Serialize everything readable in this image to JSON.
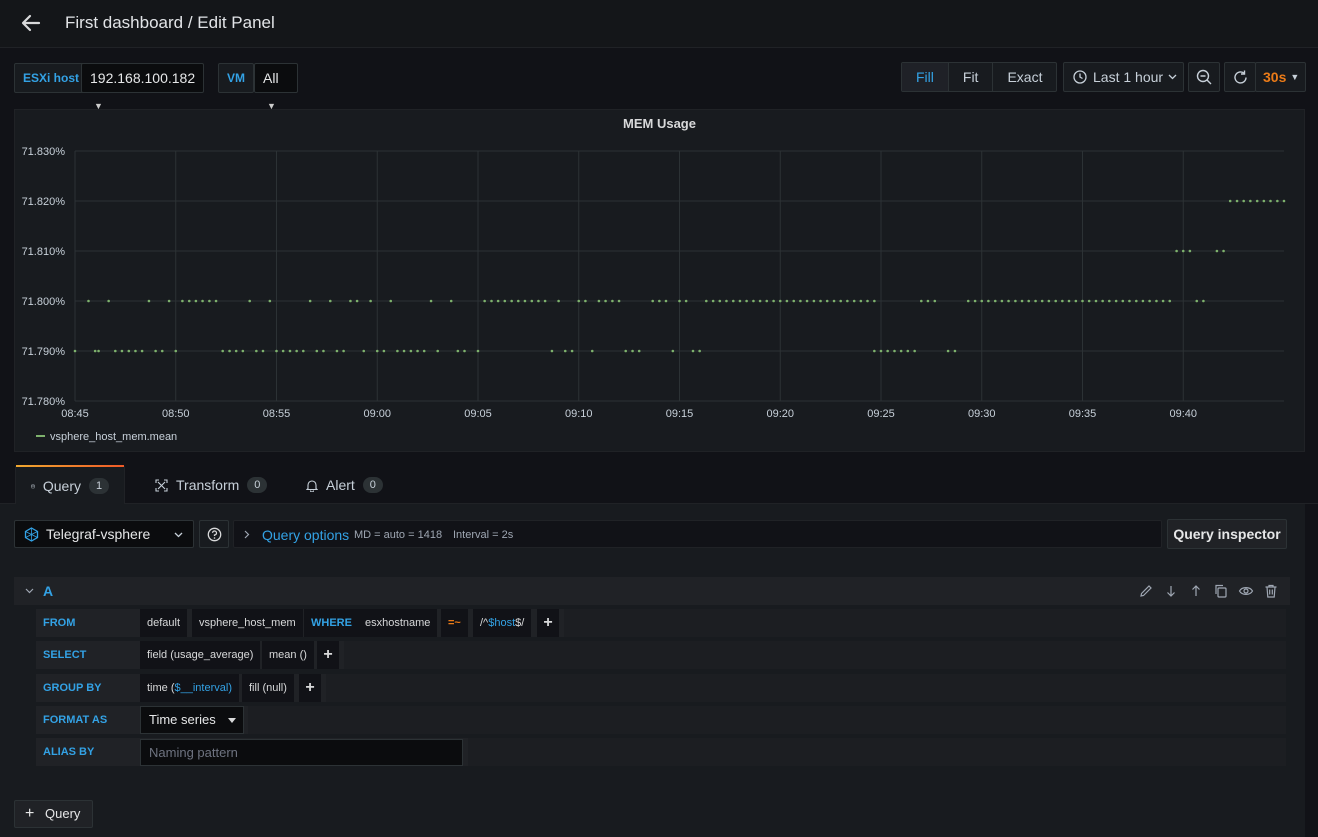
{
  "header": {
    "title": "First dashboard / Edit Panel",
    "back_icon": "arrow-left-icon"
  },
  "variables": {
    "esxi_label": "ESXi host",
    "esxi_value": "192.168.100.182",
    "vm_label": "VM",
    "vm_value": "All"
  },
  "view_modes": {
    "fill": "Fill",
    "fit": "Fit",
    "exact": "Exact",
    "active": "Fill"
  },
  "time_picker": {
    "range": "Last 1 hour",
    "refresh": "30s"
  },
  "panel": {
    "title": "MEM Usage"
  },
  "chart_data": {
    "type": "scatter",
    "title": "MEM Usage",
    "xlabel": "",
    "ylabel": "",
    "x_ticks": [
      "08:45",
      "08:50",
      "08:55",
      "09:00",
      "09:05",
      "09:10",
      "09:15",
      "09:20",
      "09:25",
      "09:30",
      "09:35",
      "09:40"
    ],
    "y_ticks": [
      "71.830%",
      "71.820%",
      "71.810%",
      "71.800%",
      "71.790%",
      "71.780%"
    ],
    "ylim": [
      71.78,
      71.83
    ],
    "xlim_minutes": [
      0,
      60
    ],
    "grid": true,
    "legend_position": "bottom-left",
    "series_color": "#7eb26d",
    "series": [
      {
        "name": "vsphere_host_mem.mean",
        "points": [
          [
            0.0,
            71.79
          ],
          [
            0.67,
            71.8
          ],
          [
            1.0,
            71.79
          ],
          [
            1.17,
            71.79
          ],
          [
            1.67,
            71.8
          ],
          [
            2.0,
            71.79
          ],
          [
            2.33,
            71.79
          ],
          [
            2.67,
            71.79
          ],
          [
            3.0,
            71.79
          ],
          [
            3.33,
            71.79
          ],
          [
            3.67,
            71.8
          ],
          [
            4.0,
            71.79
          ],
          [
            4.33,
            71.79
          ],
          [
            4.67,
            71.8
          ],
          [
            5.0,
            71.79
          ],
          [
            5.33,
            71.8
          ],
          [
            5.67,
            71.8
          ],
          [
            6.0,
            71.8
          ],
          [
            6.33,
            71.8
          ],
          [
            6.67,
            71.8
          ],
          [
            7.0,
            71.8
          ],
          [
            7.33,
            71.79
          ],
          [
            7.67,
            71.79
          ],
          [
            8.0,
            71.79
          ],
          [
            8.33,
            71.79
          ],
          [
            8.67,
            71.8
          ],
          [
            9.0,
            71.79
          ],
          [
            9.33,
            71.79
          ],
          [
            9.67,
            71.8
          ],
          [
            10.0,
            71.79
          ],
          [
            10.33,
            71.79
          ],
          [
            10.67,
            71.79
          ],
          [
            11.0,
            71.79
          ],
          [
            11.33,
            71.79
          ],
          [
            11.67,
            71.8
          ],
          [
            12.0,
            71.79
          ],
          [
            12.33,
            71.79
          ],
          [
            12.67,
            71.8
          ],
          [
            13.0,
            71.79
          ],
          [
            13.33,
            71.79
          ],
          [
            13.67,
            71.8
          ],
          [
            14.0,
            71.8
          ],
          [
            14.33,
            71.79
          ],
          [
            14.67,
            71.8
          ],
          [
            15.0,
            71.79
          ],
          [
            15.33,
            71.79
          ],
          [
            15.67,
            71.8
          ],
          [
            16.0,
            71.79
          ],
          [
            16.33,
            71.79
          ],
          [
            16.67,
            71.79
          ],
          [
            17.0,
            71.79
          ],
          [
            17.33,
            71.79
          ],
          [
            17.67,
            71.8
          ],
          [
            18.0,
            71.79
          ],
          [
            18.67,
            71.8
          ],
          [
            19.0,
            71.79
          ],
          [
            19.33,
            71.79
          ],
          [
            20.0,
            71.79
          ],
          [
            20.33,
            71.8
          ],
          [
            20.67,
            71.8
          ],
          [
            21.0,
            71.8
          ],
          [
            21.33,
            71.8
          ],
          [
            21.67,
            71.8
          ],
          [
            22.0,
            71.8
          ],
          [
            22.33,
            71.8
          ],
          [
            22.67,
            71.8
          ],
          [
            23.0,
            71.8
          ],
          [
            23.33,
            71.8
          ],
          [
            23.67,
            71.79
          ],
          [
            24.0,
            71.8
          ],
          [
            24.33,
            71.79
          ],
          [
            24.67,
            71.79
          ],
          [
            25.0,
            71.8
          ],
          [
            25.33,
            71.8
          ],
          [
            25.67,
            71.79
          ],
          [
            26.0,
            71.8
          ],
          [
            26.33,
            71.8
          ],
          [
            26.67,
            71.8
          ],
          [
            27.0,
            71.8
          ],
          [
            27.33,
            71.79
          ],
          [
            27.67,
            71.79
          ],
          [
            28.0,
            71.79
          ],
          [
            28.67,
            71.8
          ],
          [
            29.0,
            71.8
          ],
          [
            29.33,
            71.8
          ],
          [
            29.67,
            71.79
          ],
          [
            30.0,
            71.8
          ],
          [
            30.33,
            71.8
          ],
          [
            30.67,
            71.79
          ],
          [
            31.0,
            71.79
          ],
          [
            31.33,
            71.8
          ],
          [
            31.67,
            71.8
          ],
          [
            32.0,
            71.8
          ],
          [
            32.33,
            71.8
          ],
          [
            32.67,
            71.8
          ],
          [
            33.0,
            71.8
          ],
          [
            33.33,
            71.8
          ],
          [
            33.67,
            71.8
          ],
          [
            34.0,
            71.8
          ],
          [
            34.33,
            71.8
          ],
          [
            34.67,
            71.8
          ],
          [
            35.0,
            71.8
          ],
          [
            35.33,
            71.8
          ],
          [
            35.67,
            71.8
          ],
          [
            36.0,
            71.8
          ],
          [
            36.33,
            71.8
          ],
          [
            36.67,
            71.8
          ],
          [
            37.0,
            71.8
          ],
          [
            37.33,
            71.8
          ],
          [
            37.67,
            71.8
          ],
          [
            38.0,
            71.8
          ],
          [
            38.33,
            71.8
          ],
          [
            38.67,
            71.8
          ],
          [
            39.0,
            71.8
          ],
          [
            39.33,
            71.8
          ],
          [
            39.67,
            71.79
          ],
          [
            39.67,
            71.8
          ],
          [
            40.0,
            71.79
          ],
          [
            40.33,
            71.79
          ],
          [
            40.67,
            71.79
          ],
          [
            41.0,
            71.79
          ],
          [
            41.33,
            71.79
          ],
          [
            41.67,
            71.79
          ],
          [
            42.0,
            71.8
          ],
          [
            42.33,
            71.8
          ],
          [
            42.67,
            71.8
          ],
          [
            43.33,
            71.79
          ],
          [
            43.67,
            71.79
          ],
          [
            44.33,
            71.8
          ],
          [
            44.67,
            71.8
          ],
          [
            45.0,
            71.8
          ],
          [
            45.33,
            71.8
          ],
          [
            45.67,
            71.8
          ],
          [
            46.0,
            71.8
          ],
          [
            46.33,
            71.8
          ],
          [
            46.67,
            71.8
          ],
          [
            47.0,
            71.8
          ],
          [
            47.33,
            71.8
          ],
          [
            47.67,
            71.8
          ],
          [
            48.0,
            71.8
          ],
          [
            48.33,
            71.8
          ],
          [
            48.67,
            71.8
          ],
          [
            49.0,
            71.8
          ],
          [
            49.33,
            71.8
          ],
          [
            49.67,
            71.8
          ],
          [
            50.0,
            71.8
          ],
          [
            50.33,
            71.8
          ],
          [
            50.67,
            71.8
          ],
          [
            51.0,
            71.8
          ],
          [
            51.33,
            71.8
          ],
          [
            51.67,
            71.8
          ],
          [
            52.0,
            71.8
          ],
          [
            52.33,
            71.8
          ],
          [
            52.67,
            71.8
          ],
          [
            53.0,
            71.8
          ],
          [
            53.33,
            71.8
          ],
          [
            53.67,
            71.8
          ],
          [
            54.0,
            71.8
          ],
          [
            54.33,
            71.8
          ],
          [
            54.67,
            71.81
          ],
          [
            55.0,
            71.81
          ],
          [
            55.33,
            71.81
          ],
          [
            55.67,
            71.8
          ],
          [
            56.0,
            71.8
          ],
          [
            56.67,
            71.81
          ],
          [
            57.0,
            71.81
          ],
          [
            57.33,
            71.82
          ],
          [
            57.67,
            71.82
          ],
          [
            58.0,
            71.82
          ],
          [
            58.33,
            71.82
          ],
          [
            58.67,
            71.82
          ],
          [
            59.0,
            71.82
          ],
          [
            59.33,
            71.82
          ],
          [
            59.67,
            71.82
          ],
          [
            60.0,
            71.82
          ]
        ]
      }
    ]
  },
  "tabs": [
    {
      "label": "Query",
      "count": "1",
      "active": true,
      "icon": "database-icon"
    },
    {
      "label": "Transform",
      "count": "0",
      "active": false,
      "icon": "transform-icon"
    },
    {
      "label": "Alert",
      "count": "0",
      "active": false,
      "icon": "bell-icon"
    }
  ],
  "datasource": {
    "name": "Telegraf-vsphere"
  },
  "query_options": {
    "label": "Query options",
    "md": "MD = auto = 1418",
    "interval": "Interval = 2s"
  },
  "query_inspector": "Query inspector",
  "query": {
    "ref": "A",
    "from": {
      "kw": "FROM",
      "policy": "default",
      "measurement": "vsphere_host_mem",
      "where_kw": "WHERE",
      "tag": "esxhostname",
      "op": "=~",
      "value_pre": "/^",
      "value_var": "$host",
      "value_post": "$/"
    },
    "select": {
      "kw": "SELECT",
      "field": "field (usage_average)",
      "fn": "mean ()"
    },
    "group_by": {
      "kw": "GROUP BY",
      "time_pre": "time (",
      "time_var": "$__interval",
      "time_post": ")",
      "fill": "fill (null)"
    },
    "format_as": {
      "kw": "FORMAT AS",
      "value": "Time series"
    },
    "alias_by": {
      "kw": "ALIAS BY",
      "placeholder": "Naming pattern"
    },
    "plus": "+"
  },
  "add_query": {
    "plus": "+",
    "label": "Query"
  }
}
